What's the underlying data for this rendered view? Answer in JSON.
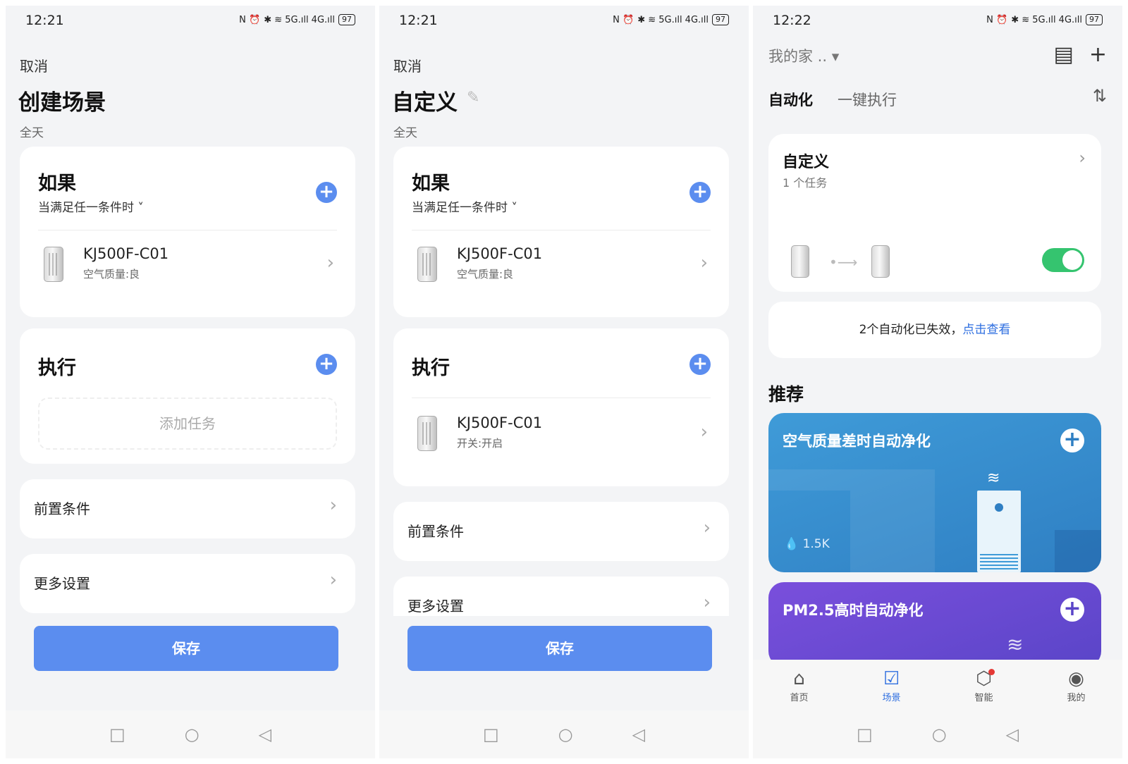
{
  "screens": [
    {
      "status": {
        "time": "12:21",
        "left_icons": "N ⏰",
        "right_icons": "✱ ≋ 5G.ıll 4G.ıll",
        "battery": "97"
      },
      "cancel": "取消",
      "title": "创建场景",
      "schedule": "全天",
      "if_card": {
        "title": "如果",
        "condition": "当满足任一条件时 ˅",
        "device_name": "KJ500F-C01",
        "device_state": "空气质量:良"
      },
      "do_card": {
        "title": "执行",
        "add_task": "添加任务"
      },
      "precondition": "前置条件",
      "more_settings": "更多设置",
      "save": "保存"
    },
    {
      "status": {
        "time": "12:21",
        "left_icons": "N ⏰",
        "right_icons": "✱ ≋ 5G.ıll 4G.ıll",
        "battery": "97"
      },
      "cancel": "取消",
      "title": "自定义",
      "schedule": "全天",
      "if_card": {
        "title": "如果",
        "condition": "当满足任一条件时 ˅",
        "device_name": "KJ500F-C01",
        "device_state": "空气质量:良"
      },
      "do_card": {
        "title": "执行",
        "device_name": "KJ500F-C01",
        "device_state": "开关:开启"
      },
      "precondition": "前置条件",
      "more_settings": "更多设置",
      "save": "保存"
    },
    {
      "status": {
        "time": "12:22",
        "left_icons": "N ⏰",
        "right_icons": "✱ ≋ 5G.ıll 4G.ıll",
        "battery": "97"
      },
      "home": "我的家 .. ▾",
      "tabs": [
        "自动化",
        "一键执行"
      ],
      "automation": {
        "title": "自定义",
        "subtitle": "1 个任务",
        "enabled": true
      },
      "notice": {
        "text": "2个自动化已失效，",
        "link": "点击查看"
      },
      "recommend_title": "推荐",
      "recommendations": [
        {
          "title": "空气质量差时自动净化",
          "count": "1.5K",
          "color": "#3f9bd8"
        },
        {
          "title": "PM2.5高时自动净化",
          "color": "#6a4ad8"
        }
      ],
      "tabbar": [
        "首页",
        "场景",
        "智能",
        "我的"
      ],
      "active_tab": "场景"
    }
  ],
  "colors": {
    "accent": "#5b8def",
    "toggle_on": "#35c46f",
    "link": "#2f6fe0"
  }
}
